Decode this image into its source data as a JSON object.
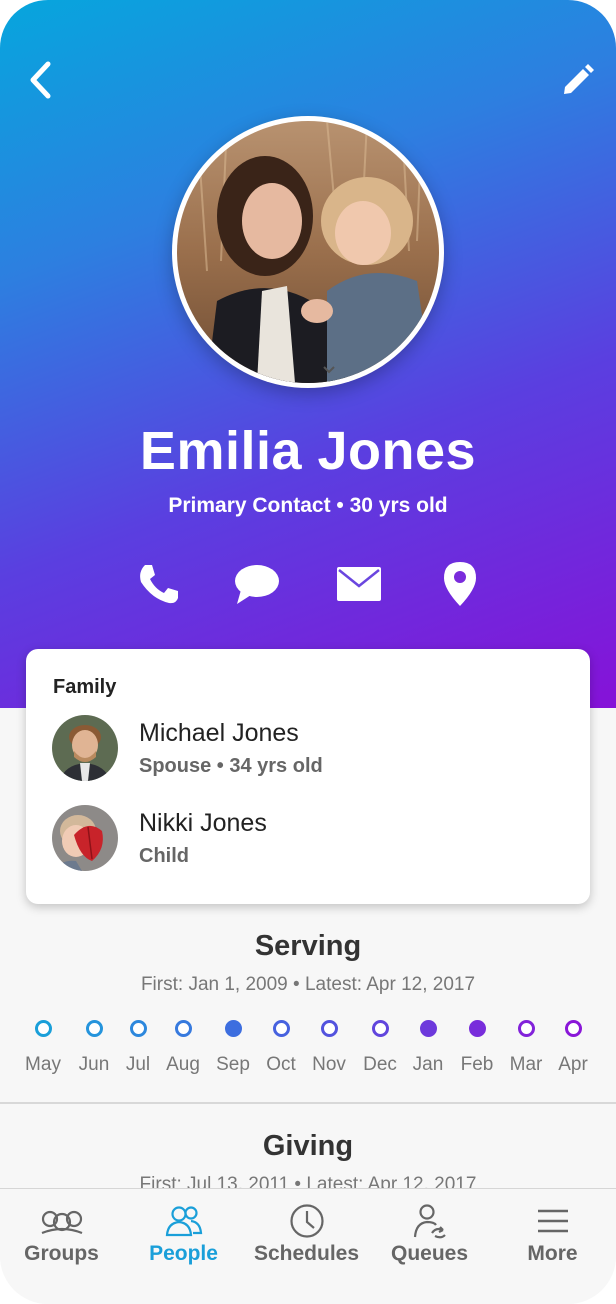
{
  "profile": {
    "name": "Emilia Jones",
    "subtitle": "Primary Contact • 30 yrs old"
  },
  "header": {
    "back_icon": "chevron-left-icon",
    "edit_icon": "pencil-icon"
  },
  "actions": [
    {
      "icon": "phone-icon"
    },
    {
      "icon": "chat-bubble-icon"
    },
    {
      "icon": "envelope-icon"
    },
    {
      "icon": "map-pin-icon"
    }
  ],
  "family": {
    "title": "Family",
    "members": [
      {
        "name": "Michael Jones",
        "relation": "Spouse • 34 yrs old"
      },
      {
        "name": "Nikki Jones",
        "relation": "Child"
      }
    ]
  },
  "serving": {
    "title": "Serving",
    "dates": "First: Jan 1, 2009 • Latest: Apr 12, 2017",
    "months": [
      {
        "label": "May",
        "filled": false,
        "color": "#1a9fd9"
      },
      {
        "label": "Jun",
        "filled": false,
        "color": "#2594dc"
      },
      {
        "label": "Jul",
        "filled": false,
        "color": "#2d88dd"
      },
      {
        "label": "Aug",
        "filled": false,
        "color": "#377ade"
      },
      {
        "label": "Sep",
        "filled": true,
        "color": "#3d6edf"
      },
      {
        "label": "Oct",
        "filled": false,
        "color": "#4762df"
      },
      {
        "label": "Nov",
        "filled": false,
        "color": "#5353de"
      },
      {
        "label": "Dec",
        "filled": false,
        "color": "#6146dd"
      },
      {
        "label": "Jan",
        "filled": true,
        "color": "#6d39dc"
      },
      {
        "label": "Feb",
        "filled": true,
        "color": "#782ddb"
      },
      {
        "label": "Mar",
        "filled": false,
        "color": "#8222da"
      },
      {
        "label": "Apr",
        "filled": false,
        "color": "#8a17d8"
      }
    ]
  },
  "giving": {
    "title": "Giving",
    "dates": "First: Jul 13, 2011 • Latest: Apr 12, 2017"
  },
  "tabs": [
    {
      "label": "Groups",
      "icon": "groups-icon",
      "active": false
    },
    {
      "label": "People",
      "icon": "people-icon",
      "active": true
    },
    {
      "label": "Schedules",
      "icon": "clock-icon",
      "active": false
    },
    {
      "label": "Queues",
      "icon": "queue-person-icon",
      "active": false
    },
    {
      "label": "More",
      "icon": "hamburger-menu-icon",
      "active": false
    }
  ],
  "colors": {
    "accent": "#1a9fd9",
    "gradient_start": "#06a6dd",
    "gradient_end": "#8612d8"
  }
}
